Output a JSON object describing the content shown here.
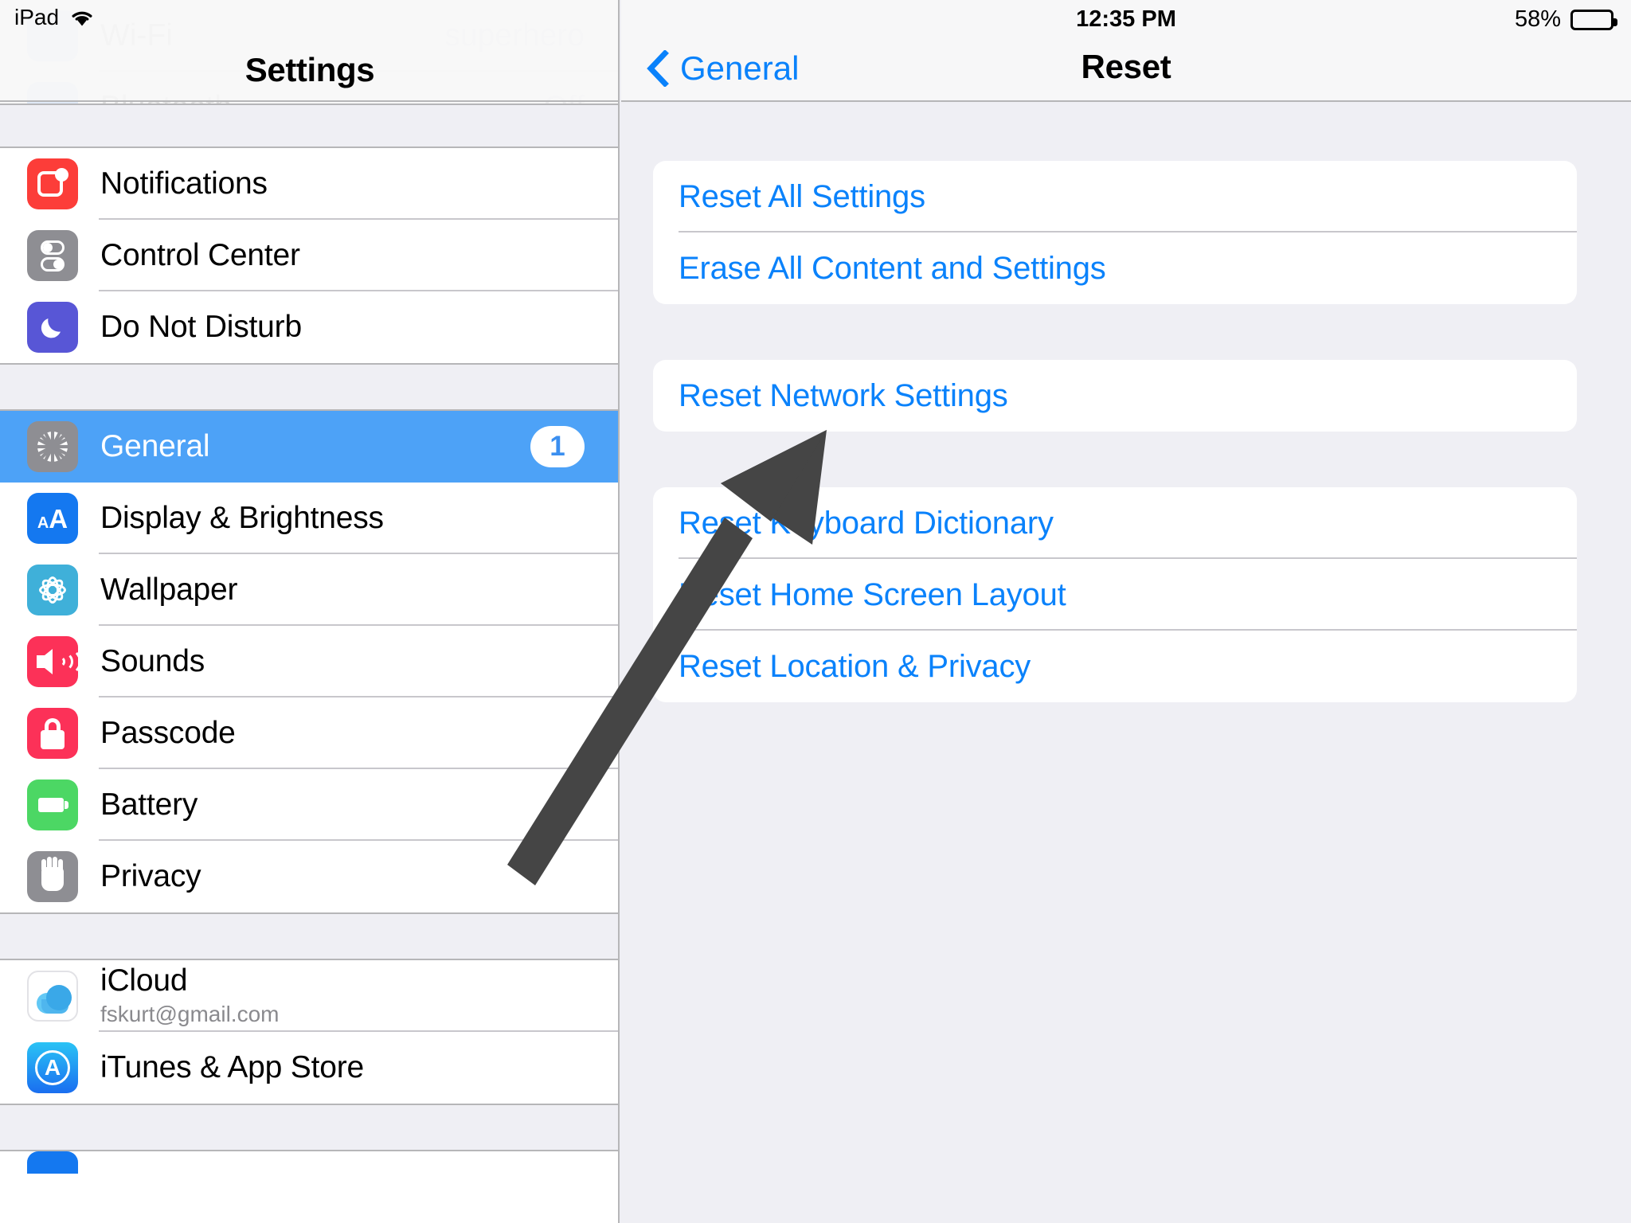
{
  "status_bar": {
    "device_label": "iPad",
    "wifi_icon": "wifi-icon",
    "time": "12:35 PM",
    "battery_percent": "58%",
    "battery_level": 58
  },
  "sidebar": {
    "title": "Settings",
    "scrolled_under_rows": [
      {
        "label": "Wi-Fi",
        "value": "superhero",
        "icon": "wifi-settings-icon",
        "icon_color": "#1478f0"
      },
      {
        "label": "Bluetooth",
        "value": "Off",
        "icon": "bluetooth-icon",
        "icon_color": "#1478f0"
      }
    ],
    "groups": [
      {
        "items": [
          {
            "label": "Notifications",
            "icon": "notifications-icon",
            "selected": false
          },
          {
            "label": "Control Center",
            "icon": "control-center-icon",
            "selected": false
          },
          {
            "label": "Do Not Disturb",
            "icon": "do-not-disturb-icon",
            "selected": false
          }
        ]
      },
      {
        "items": [
          {
            "label": "General",
            "icon": "general-gear-icon",
            "selected": true,
            "badge": "1"
          },
          {
            "label": "Display & Brightness",
            "icon": "display-brightness-icon",
            "selected": false
          },
          {
            "label": "Wallpaper",
            "icon": "wallpaper-icon",
            "selected": false
          },
          {
            "label": "Sounds",
            "icon": "sounds-icon",
            "selected": false
          },
          {
            "label": "Passcode",
            "icon": "passcode-lock-icon",
            "selected": false
          },
          {
            "label": "Battery",
            "icon": "battery-icon",
            "selected": false
          },
          {
            "label": "Privacy",
            "icon": "privacy-hand-icon",
            "selected": false
          }
        ]
      },
      {
        "items": [
          {
            "label": "iCloud",
            "subtitle": "fskurt@gmail.com",
            "icon": "icloud-icon",
            "selected": false
          },
          {
            "label": "iTunes & App Store",
            "icon": "itunes-app-store-icon",
            "selected": false
          }
        ]
      }
    ]
  },
  "detail": {
    "back_label": "General",
    "back_icon": "chevron-left-icon",
    "title": "Reset",
    "groups": [
      {
        "rows": [
          {
            "label": "Reset All Settings"
          },
          {
            "label": "Erase All Content and Settings"
          }
        ]
      },
      {
        "rows": [
          {
            "label": "Reset Network Settings"
          }
        ]
      },
      {
        "rows": [
          {
            "label": "Reset Keyboard Dictionary"
          },
          {
            "label": "Reset Home Screen Layout"
          },
          {
            "label": "Reset Location & Privacy"
          }
        ]
      }
    ]
  },
  "annotation": {
    "arrow_icon": "annotation-arrow-icon",
    "color": "#454545",
    "points_to": "Reset Network Settings"
  },
  "colors": {
    "accent_blue": "#0a82fb",
    "selection_blue": "#4da2f7",
    "group_background": "#efeff4",
    "row_background": "#ffffff",
    "separator": "#c8c7cc"
  }
}
